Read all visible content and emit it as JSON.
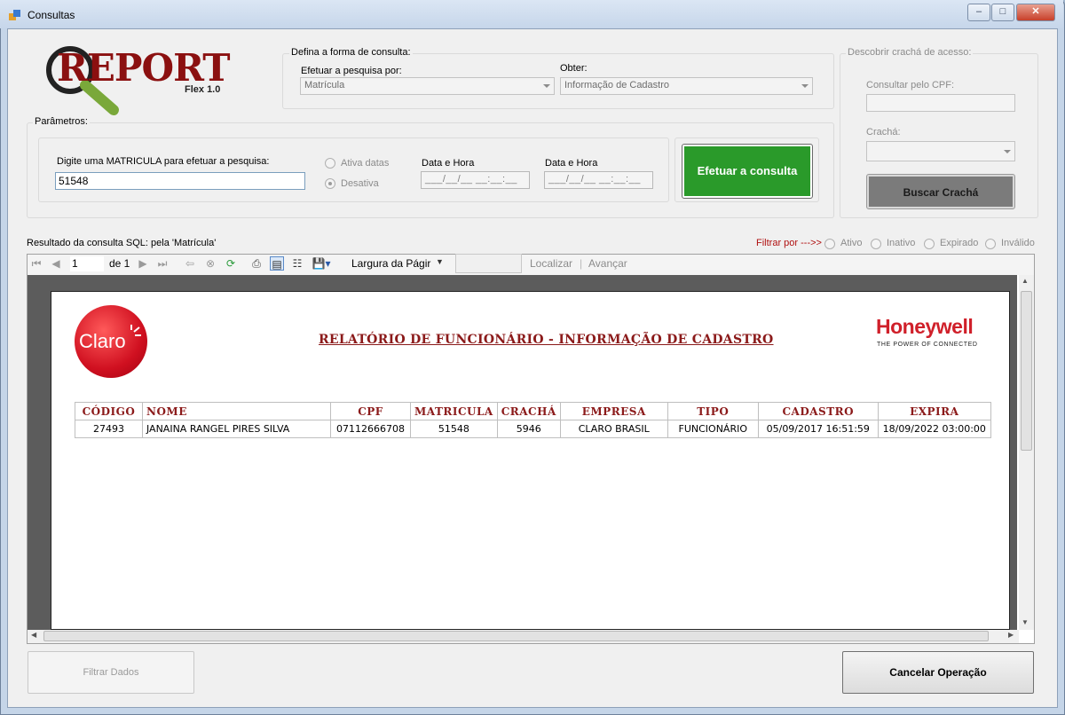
{
  "window": {
    "title": "Consultas"
  },
  "logo": {
    "brand": "REPORT",
    "version": "Flex 1.0"
  },
  "consulta": {
    "group_title": "Defina a forma de consulta:",
    "pesquisa_label": "Efetuar a pesquisa por:",
    "pesquisa_value": "Matrícula",
    "obter_label": "Obter:",
    "obter_value": "Informação de Cadastro"
  },
  "cracha": {
    "group_title": "Descobrir crachá de acesso:",
    "cpf_label": "Consultar pelo CPF:",
    "cracha_label": "Crachá:",
    "buscar_button": "Buscar Crachá"
  },
  "parametros": {
    "group_title": "Parâmetros:",
    "input_label": "Digite uma MATRICULA para efetuar a pesquisa:",
    "input_value": "51548",
    "ativa_datas": "Ativa datas",
    "desativa": "Desativa",
    "data_hora_1_label": "Data e Hora",
    "data_hora_1_value": "___/__/__ __:__:__",
    "data_hora_2_label": "Data e Hora",
    "data_hora_2_value": "___/__/__ __:__:__",
    "consultar_button": "Efetuar a consulta"
  },
  "resultado": {
    "label": "Resultado da consulta SQL: pela 'Matrícula'",
    "filtrar_label": "Filtrar por  --->>",
    "filters": [
      "Ativo",
      "Inativo",
      "Expirado",
      "Inválido"
    ]
  },
  "toolbar": {
    "page_current": "1",
    "page_of": "de 1",
    "zoom": "Largura da Págir",
    "find_label": "Localizar",
    "next_label": "Avançar"
  },
  "report": {
    "claro_logo": "Claro",
    "title": "RELATÓRIO DE FUNCIONÁRIO - INFORMAÇÃO DE CADASTRO",
    "honeywell_logo": "Honeywell",
    "honeywell_tagline": "THE POWER OF CONNECTED",
    "headers": [
      "CÓDIGO",
      "NOME",
      "CPF",
      "MATRICULA",
      "CRACHÁ",
      "EMPRESA",
      "TIPO",
      "CADASTRO",
      "EXPIRA"
    ],
    "rows": [
      [
        "27493",
        "JANAINA RANGEL PIRES SILVA",
        "07112666708",
        "51548",
        "5946",
        "CLARO BRASIL",
        "FUNCIONÁRIO",
        "05/09/2017 16:51:59",
        "18/09/2022 03:00:00"
      ]
    ]
  },
  "footer": {
    "filtrar_button": "Filtrar Dados",
    "cancelar_button": "Cancelar Operação"
  },
  "colors": {
    "green_button": "#2a9a2a",
    "report_title": "#8b1a1a",
    "claro_red": "#e0202a",
    "honeywell_red": "#d0202a"
  }
}
